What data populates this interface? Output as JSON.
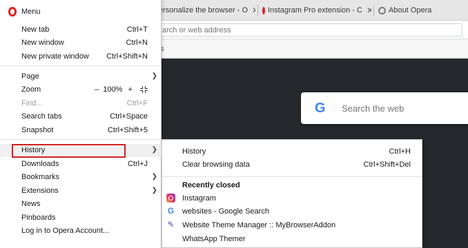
{
  "tabs": [
    {
      "label": "ersonalize the browser - O"
    },
    {
      "label": "Instagram Pro extension - C"
    },
    {
      "label": "About Opera"
    }
  ],
  "address": {
    "placeholder": "arch or web address"
  },
  "bookmarks_fragment": "s",
  "search": {
    "placeholder": "Search the web",
    "logo": "G"
  },
  "menu": {
    "title": "Menu",
    "items": {
      "new_tab": {
        "label": "New tab",
        "shortcut": "Ctrl+T"
      },
      "new_window": {
        "label": "New window",
        "shortcut": "Ctrl+N"
      },
      "new_private": {
        "label": "New private window",
        "shortcut": "Ctrl+Shift+N"
      },
      "page": {
        "label": "Page"
      },
      "zoom": {
        "label": "Zoom",
        "minus": "–",
        "value": "100%",
        "plus": "+"
      },
      "find": {
        "label": "Find...",
        "shortcut": "Ctrl+F"
      },
      "search_tabs": {
        "label": "Search tabs",
        "shortcut": "Ctrl+Space"
      },
      "snapshot": {
        "label": "Snapshot",
        "shortcut": "Ctrl+Shift+5"
      },
      "history": {
        "label": "History"
      },
      "downloads": {
        "label": "Downloads",
        "shortcut": "Ctrl+J"
      },
      "bookmarks": {
        "label": "Bookmarks"
      },
      "extensions": {
        "label": "Extensions"
      },
      "news": {
        "label": "News"
      },
      "pinboards": {
        "label": "Pinboards"
      },
      "login": {
        "label": "Log in to Opera Account..."
      }
    }
  },
  "history_submenu": {
    "history": {
      "label": "History",
      "shortcut": "Ctrl+H"
    },
    "clear": {
      "label": "Clear browsing data",
      "shortcut": "Ctrl+Shift+Del"
    },
    "recently_closed_heading": "Recently closed",
    "recently_closed": [
      {
        "label": "Instagram",
        "icon": "instagram-icon"
      },
      {
        "label": "websites - Google Search",
        "icon": "google-icon"
      },
      {
        "label": "Website Theme Manager :: MyBrowserAddon",
        "icon": "wand-icon"
      },
      {
        "label": "WhatsApp Themer",
        "icon": ""
      }
    ]
  },
  "colors": {
    "opera_red": "#e0201f",
    "highlight": "#d32020",
    "speeddial_bg": "#25282d"
  }
}
